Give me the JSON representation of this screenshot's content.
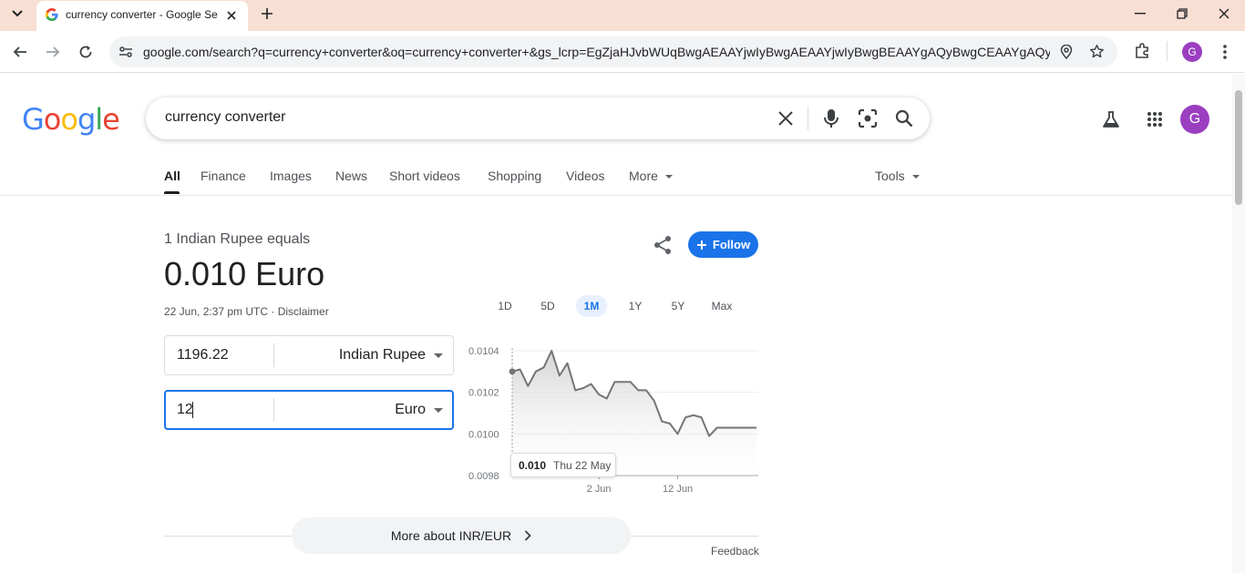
{
  "browser": {
    "tab_title": "currency converter - Google Se",
    "url": "google.com/search?q=currency+converter&oq=currency+converter+&gs_lcrp=EgZjaHJvbWUqBwgAEAAYjwIyBwgAEAAYjwIyBwgBEAAYgAQyBwgCEAAYgAQyB...",
    "profile_initial": "G",
    "icons": [
      "tab-list-icon",
      "google-favicon",
      "close-icon",
      "new-tab-icon",
      "minimize-icon",
      "restore-icon",
      "window-close-icon",
      "back-icon",
      "forward-icon",
      "reload-icon",
      "site-info-icon",
      "location-icon",
      "bookmark-star-icon",
      "extensions-icon",
      "kebab-menu-icon"
    ]
  },
  "search": {
    "query": "currency converter",
    "icons": [
      "clear-icon",
      "mic-icon",
      "lens-icon",
      "search-icon",
      "labs-icon",
      "apps-grid-icon"
    ],
    "avatar_initial": "G"
  },
  "nav_tabs": [
    {
      "label": "All",
      "active": true
    },
    {
      "label": "Finance"
    },
    {
      "label": "Images"
    },
    {
      "label": "News"
    },
    {
      "label": "Short videos"
    },
    {
      "label": "Shopping"
    },
    {
      "label": "Videos"
    },
    {
      "label": "More"
    },
    {
      "label": "Tools"
    }
  ],
  "converter": {
    "equals_label": "1 Indian Rupee equals",
    "result": "0.010 Euro",
    "timestamp": "22 Jun, 2:37 pm UTC · Disclaimer",
    "follow_label": "Follow",
    "from_value": "1196.22",
    "from_currency": "Indian Rupee",
    "to_value": "12",
    "to_currency": "Euro",
    "ranges": [
      "1D",
      "5D",
      "1M",
      "1Y",
      "5Y",
      "Max"
    ],
    "active_range": "1M",
    "tooltip_value": "0.010",
    "tooltip_date": "Thu 22 May",
    "more_label": "More about INR/EUR",
    "feedback_label": "Feedback"
  },
  "colors": {
    "accent": "#1a73e8",
    "tab_strip": "#f8dfd3",
    "avatar": "#9b3fc0",
    "chart_line": "#757575"
  },
  "chart_data": {
    "type": "area",
    "title": "",
    "xlabel": "",
    "ylabel": "",
    "ylim": [
      0.0098,
      0.0104
    ],
    "yticks": [
      "0.0104",
      "0.0102",
      "0.0100",
      "0.0098"
    ],
    "xticks": [
      "2 Jun",
      "12 Jun"
    ],
    "grid": true,
    "x": [
      "22 May",
      "23 May",
      "24 May",
      "25 May",
      "26 May",
      "27 May",
      "28 May",
      "29 May",
      "30 May",
      "31 May",
      "1 Jun",
      "2 Jun",
      "3 Jun",
      "4 Jun",
      "5 Jun",
      "6 Jun",
      "7 Jun",
      "8 Jun",
      "9 Jun",
      "10 Jun",
      "11 Jun",
      "12 Jun",
      "13 Jun",
      "14 Jun",
      "15 Jun",
      "16 Jun",
      "17 Jun",
      "18 Jun",
      "19 Jun",
      "20 Jun",
      "21 Jun",
      "22 Jun"
    ],
    "series": [
      {
        "values": [
          0.0103,
          0.01031,
          0.01023,
          0.0103,
          0.01032,
          0.0104,
          0.01028,
          0.01034,
          0.01021,
          0.01022,
          0.01024,
          0.01019,
          0.01017,
          0.01025,
          0.01025,
          0.01025,
          0.01021,
          0.01021,
          0.01016,
          0.01006,
          0.01005,
          0.01,
          0.01008,
          0.01009,
          0.01008,
          0.00999,
          0.01003,
          0.01003,
          0.01003,
          0.01003,
          0.01003,
          0.01003
        ]
      }
    ]
  }
}
